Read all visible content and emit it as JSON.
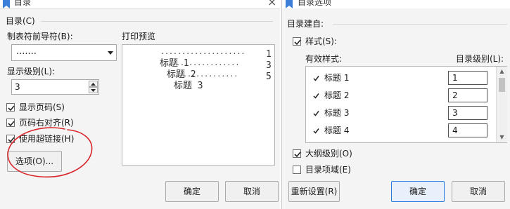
{
  "left_dialog": {
    "title": "目录",
    "tab_label": "目录(C)",
    "leader_label": "制表符前导符(B):",
    "leader_value": ".......",
    "level_label": "显示级别(L):",
    "level_value": "3",
    "show_page_numbers": {
      "label": "显示页码(S)",
      "checked": true
    },
    "align_right": {
      "label": "页码右对齐(R)",
      "checked": true
    },
    "use_hyperlinks": {
      "label": "使用超链接(H)",
      "checked": true
    },
    "options_button": "选项(O)...",
    "preview_label": "打印预览",
    "preview_lines": [
      {
        "text": "标题 1",
        "page": "1"
      },
      {
        "text": "标题 2",
        "page": "3"
      },
      {
        "text": "标题 3",
        "page": "5"
      }
    ],
    "ok_button": "确定",
    "cancel_button": "取消"
  },
  "right_dialog": {
    "title": "目录选项",
    "build_from_label": "目录建自:",
    "styles_option": {
      "label": "样式(S):",
      "checked": true
    },
    "col_available_styles": "有效样式:",
    "col_toc_level": "目录级别(L):",
    "styles": [
      {
        "name": "标题 1",
        "level": "1"
      },
      {
        "name": "标题 2",
        "level": "2"
      },
      {
        "name": "标题 3",
        "level": "3"
      },
      {
        "name": "标题 4",
        "level": "4"
      }
    ],
    "outline_level": {
      "label": "大纲级别(O)",
      "checked": true
    },
    "toc_fields": {
      "label": "目录项域(E)",
      "checked": false
    },
    "reset_button": "重新设置(R)",
    "ok_button": "确定",
    "cancel_button": "取消"
  },
  "annotation": {
    "color": "#d9262c"
  },
  "colors": {
    "accent": "#2a7be0",
    "title_icon": "#3c7fd8"
  }
}
